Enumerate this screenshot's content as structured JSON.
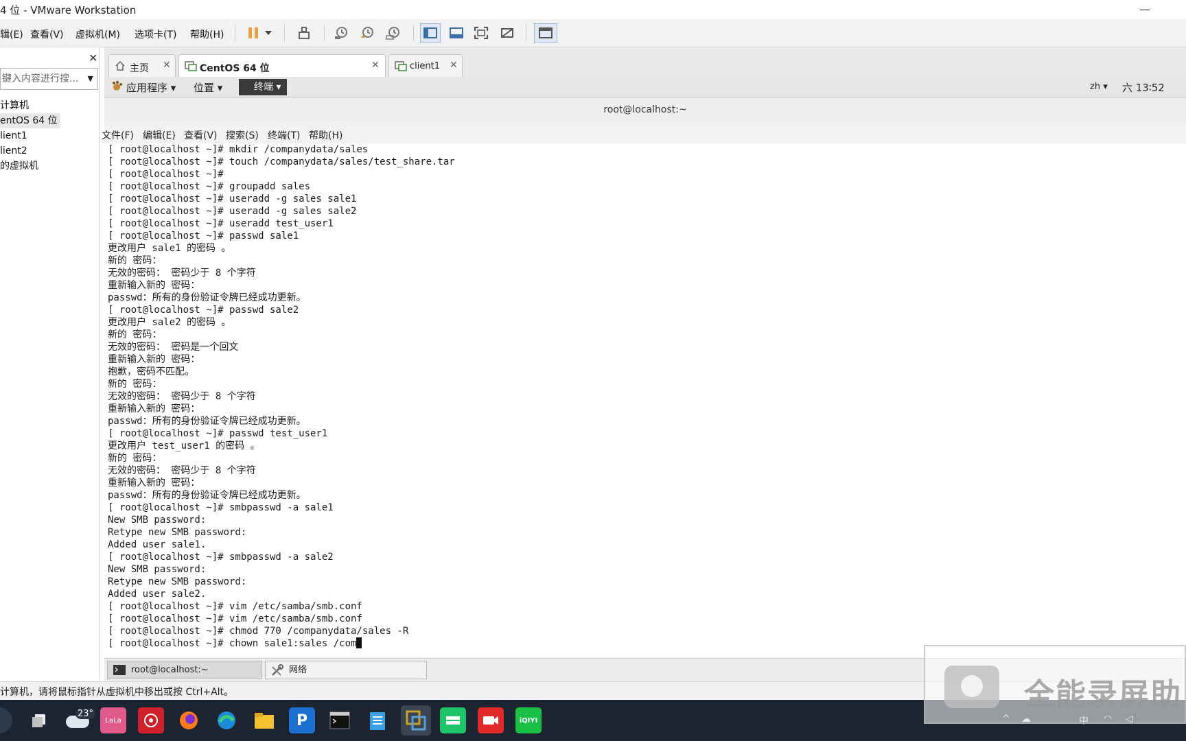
{
  "window": {
    "title": "4 位 - VMware Workstation",
    "minimize_glyph": "—"
  },
  "menubar": {
    "items": [
      "辑(E)",
      "查看(V)",
      "虚拟机(M)",
      "选项卡(T)",
      "帮助(H)"
    ]
  },
  "toolbar": {
    "icons": [
      "pause-icon",
      "dropdown-icon",
      "send-keys-icon",
      "snapshot-icon",
      "revert-snapshot-icon",
      "snapshot-manager-icon",
      "library-view-icon",
      "thumbnail-bar-icon",
      "fullscreen-icon",
      "unity-icon",
      "console-view-icon"
    ]
  },
  "sidebar": {
    "close_glyph": "✕",
    "search_placeholder": "键入内容进行搜...",
    "items": [
      "计算机",
      "entOS 64 位",
      "lient1",
      "lient2",
      "的虚拟机"
    ],
    "selected_index": 1
  },
  "tabs": [
    {
      "label": "主页",
      "icon": "home-icon",
      "active": false
    },
    {
      "label": "CentOS 64 位",
      "icon": "vm-icon",
      "active": true
    },
    {
      "label": "client1",
      "icon": "vm-icon",
      "active": false
    }
  ],
  "guest_panel": {
    "applications": "应用程序 ▾",
    "places": "位置 ▾",
    "terminal": "终端 ▾",
    "lang": "zh ▾",
    "clock": "六 13∶52"
  },
  "terminal": {
    "title": "root@localhost:~",
    "menu": [
      "文件(F)",
      "编辑(E)",
      "查看(V)",
      "搜索(S)",
      "终端(T)",
      "帮助(H)"
    ],
    "lines": [
      "[ root@localhost ~]# mkdir /companydata/sales",
      "[ root@localhost ~]# touch /companydata/sales/test_share.tar",
      "[ root@localhost ~]#",
      "[ root@localhost ~]# groupadd sales",
      "[ root@localhost ~]# useradd -g sales sale1",
      "[ root@localhost ~]# useradd -g sales sale2",
      "[ root@localhost ~]# useradd test_user1",
      "[ root@localhost ~]# passwd sale1",
      "更改用户 sale1 的密码 。",
      "新的 密码：",
      "无效的密码： 密码少于 8 个字符",
      "重新输入新的 密码：",
      "passwd：所有的身份验证令牌已经成功更新。",
      "[ root@localhost ~]# passwd sale2",
      "更改用户 sale2 的密码 。",
      "新的 密码：",
      "无效的密码： 密码是一个回文",
      "重新输入新的 密码：",
      "抱歉，密码不匹配。",
      "新的 密码：",
      "无效的密码： 密码少于 8 个字符",
      "重新输入新的 密码：",
      "passwd：所有的身份验证令牌已经成功更新。",
      "[ root@localhost ~]# passwd test_user1",
      "更改用户 test_user1 的密码 。",
      "新的 密码：",
      "无效的密码： 密码少于 8 个字符",
      "重新输入新的 密码：",
      "passwd：所有的身份验证令牌已经成功更新。",
      "[ root@localhost ~]# smbpasswd -a sale1",
      "New SMB password:",
      "Retype new SMB password:",
      "Added user sale1.",
      "[ root@localhost ~]# smbpasswd -a sale2",
      "New SMB password:",
      "Retype new SMB password:",
      "Added user sale2.",
      "[ root@localhost ~]# vim /etc/samba/smb.conf",
      "[ root@localhost ~]# vim /etc/samba/smb.conf",
      "[ root@localhost ~]# chmod 770 /companydata/sales -R",
      "[ root@localhost ~]# chown sale1:sales /com"
    ]
  },
  "guest_taskbar": [
    {
      "label": "root@localhost:~",
      "icon": "terminal-icon"
    },
    {
      "label": "网络",
      "icon": "network-tools-icon"
    }
  ],
  "statusbar": {
    "text": "计算机，请将鼠标指针从虚拟机中移出或按 Ctrl+Alt。"
  },
  "taskbar": {
    "weather_temp": "23°",
    "apps": [
      {
        "name": "task-view",
        "color": "#e6e6e6"
      },
      {
        "name": "lala",
        "color": "#e05a8a"
      },
      {
        "name": "huawei",
        "color": "#d0202a"
      },
      {
        "name": "firefox",
        "color": "#ff7a1a"
      },
      {
        "name": "edge",
        "color": "#1c8ad8"
      },
      {
        "name": "file-explorer",
        "color": "#f2c230"
      },
      {
        "name": "p-app",
        "color": "#1b6fd0"
      },
      {
        "name": "cmd",
        "color": "#111111"
      },
      {
        "name": "notepad",
        "color": "#3aa0e6"
      },
      {
        "name": "vmware",
        "color": "#c9a227"
      },
      {
        "name": "wechat-like",
        "color": "#1ec36a"
      },
      {
        "name": "recorder",
        "color": "#e02a2a"
      },
      {
        "name": "iqiyi",
        "color": "#19c046"
      }
    ],
    "iqiyi_label": "iQIYI",
    "p_label": "P",
    "lala_label": "LaLa",
    "tray_ime": "中"
  },
  "watermark": {
    "text": "全能录屏助"
  }
}
